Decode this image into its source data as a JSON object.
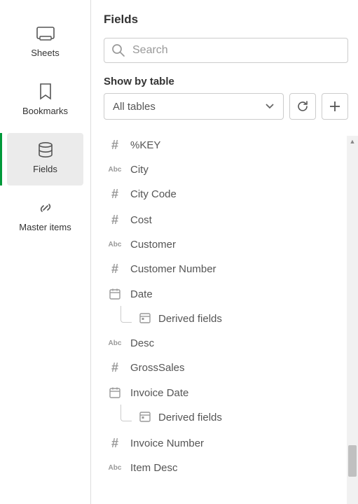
{
  "sidebar": {
    "items": [
      {
        "label": "Sheets"
      },
      {
        "label": "Bookmarks"
      },
      {
        "label": "Fields"
      },
      {
        "label": "Master items"
      }
    ]
  },
  "panel": {
    "title": "Fields",
    "search_placeholder": "Search",
    "show_by_label": "Show by table",
    "table_select_value": "All tables"
  },
  "fields": [
    {
      "type": "num",
      "name": "%KEY"
    },
    {
      "type": "abc",
      "name": "City"
    },
    {
      "type": "num",
      "name": "City Code"
    },
    {
      "type": "num",
      "name": "Cost"
    },
    {
      "type": "abc",
      "name": "Customer"
    },
    {
      "type": "num",
      "name": "Customer Number"
    },
    {
      "type": "cal",
      "name": "Date",
      "derived": "Derived fields"
    },
    {
      "type": "abc",
      "name": "Desc"
    },
    {
      "type": "num",
      "name": "GrossSales"
    },
    {
      "type": "cal",
      "name": "Invoice Date",
      "derived": "Derived fields"
    },
    {
      "type": "num",
      "name": "Invoice Number"
    },
    {
      "type": "abc",
      "name": "Item Desc"
    }
  ]
}
